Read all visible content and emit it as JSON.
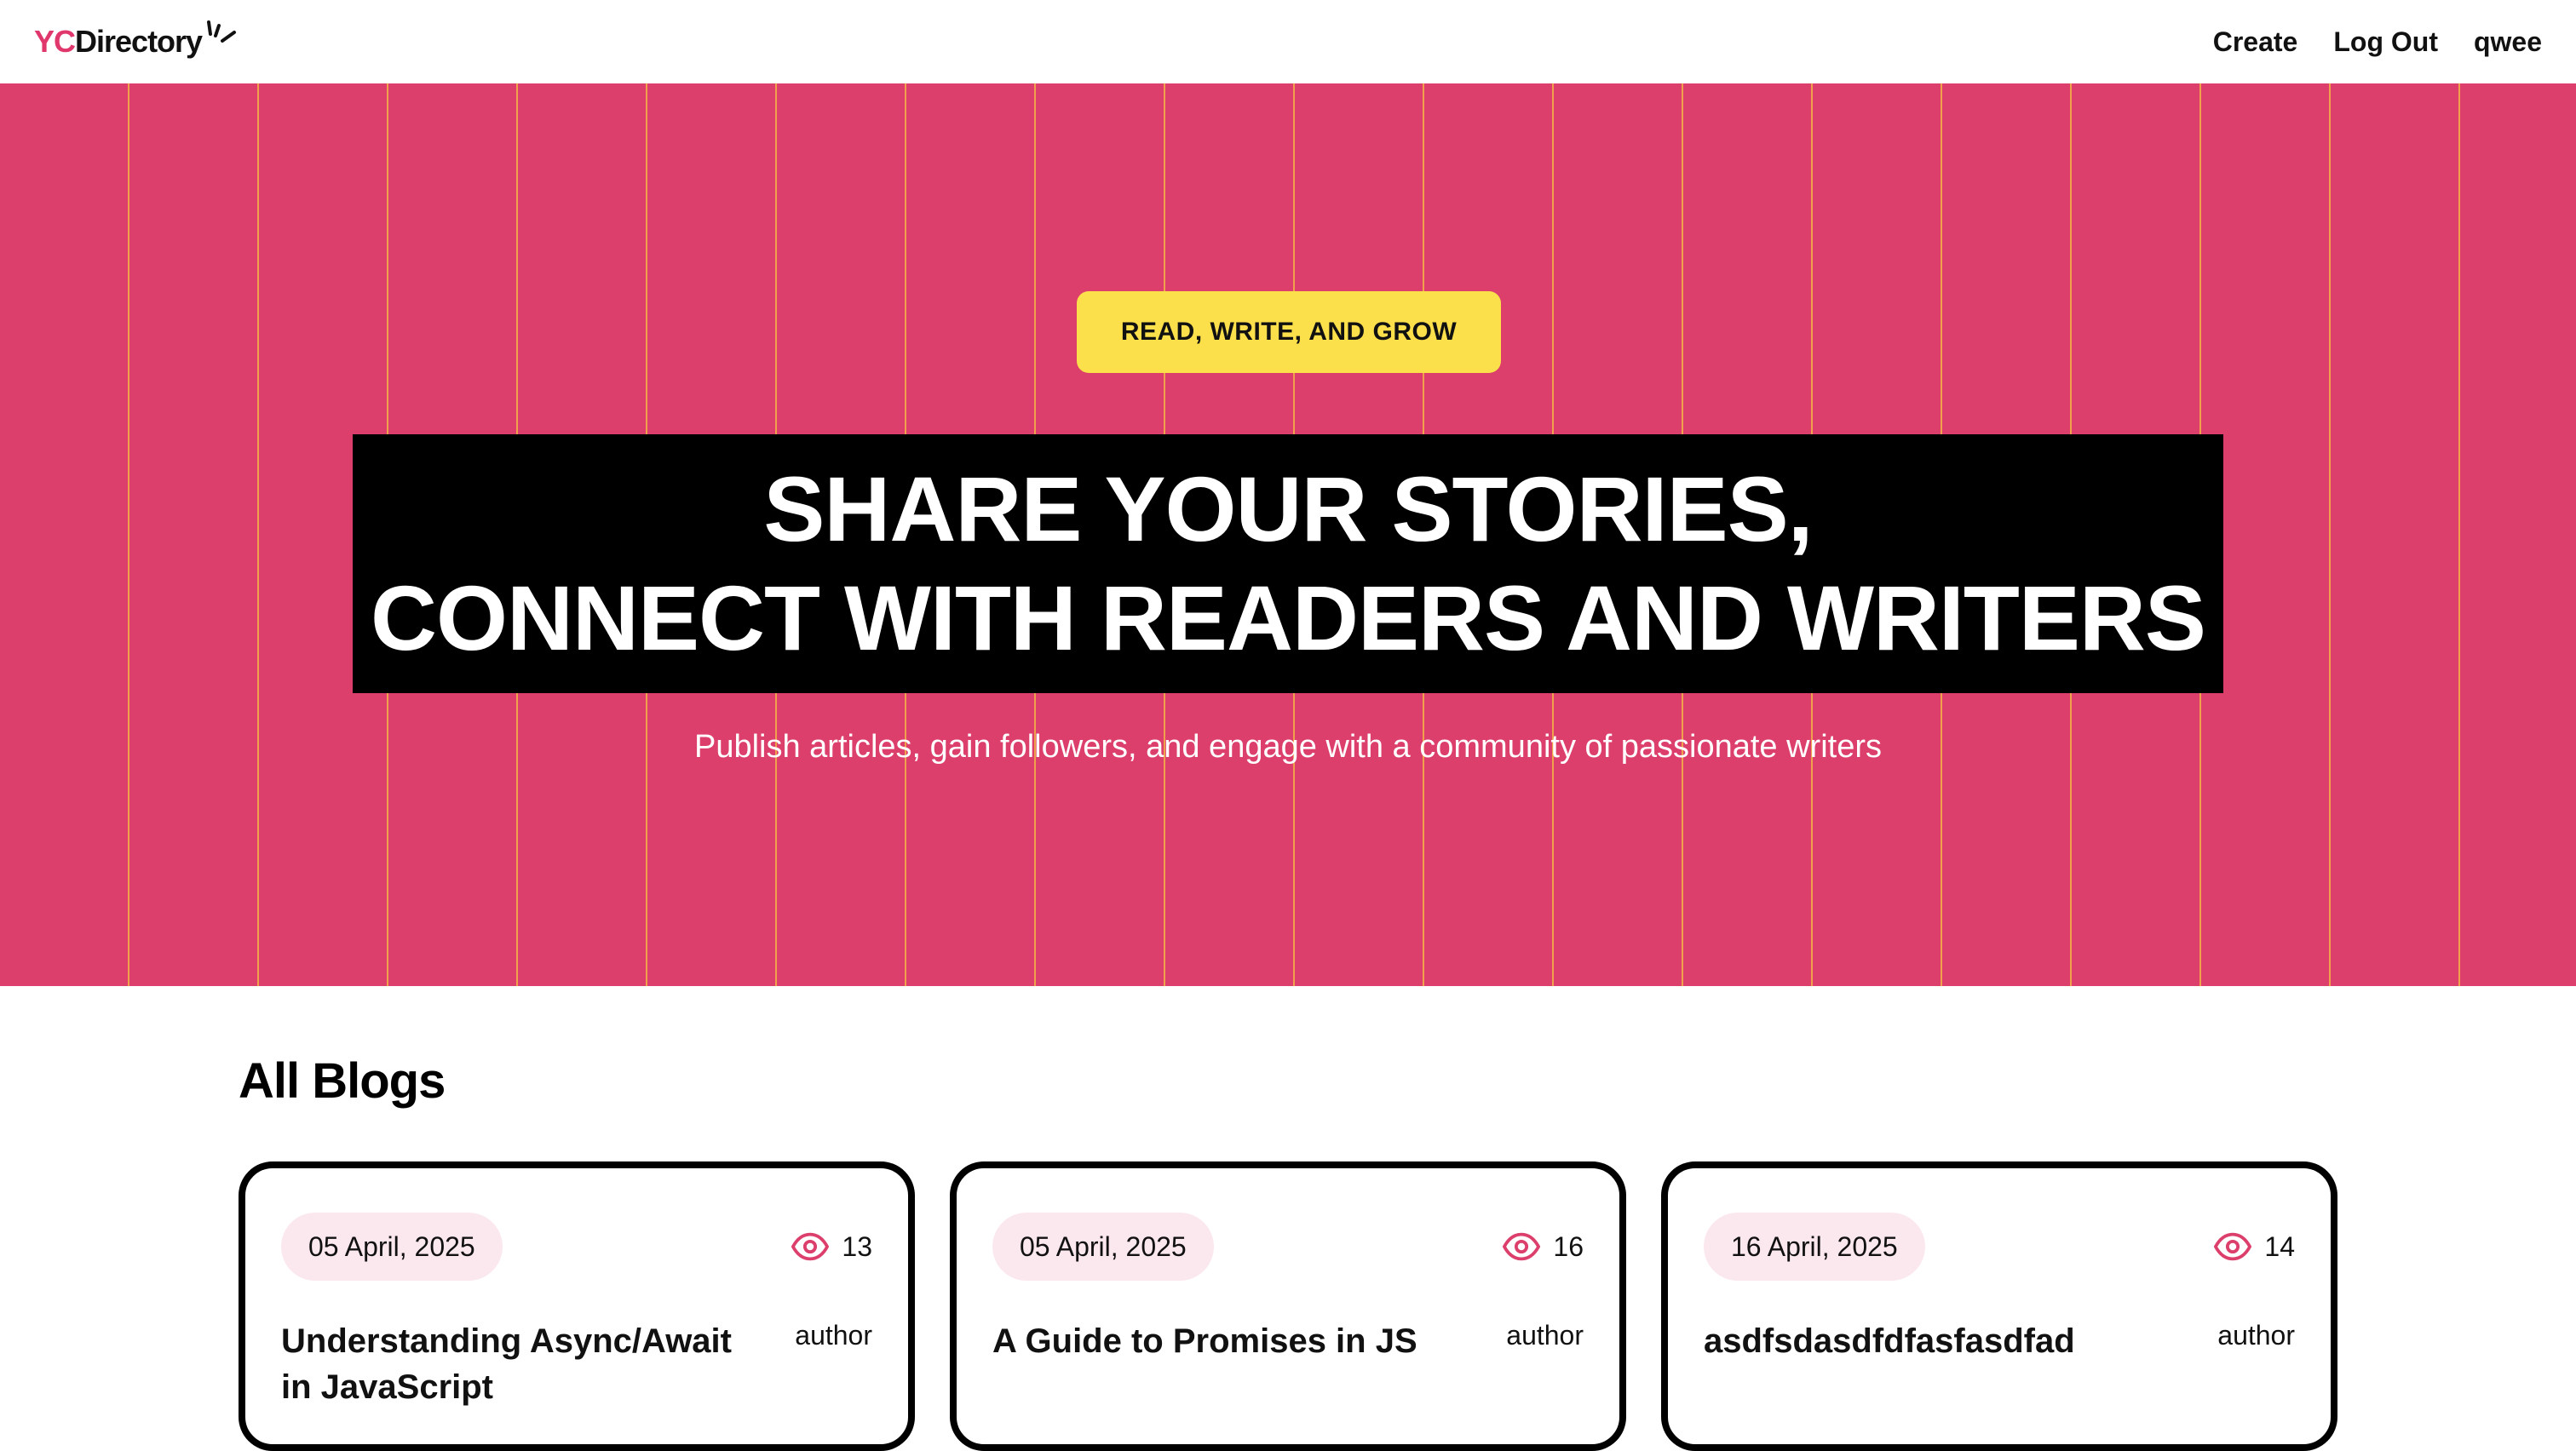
{
  "navbar": {
    "logo_prefix": "YC",
    "logo_suffix": "Directory",
    "links": {
      "create": "Create",
      "logout": "Log Out",
      "user": "qwee"
    }
  },
  "hero": {
    "tag": "READ, WRITE, AND GROW",
    "headline_line1": "SHARE YOUR STORIES,",
    "headline_line2": "CONNECT WITH READERS AND WRITERS",
    "subtitle": "Publish articles, gain followers, and engage with a community of passionate writers"
  },
  "blogs": {
    "section_title": "All Blogs",
    "cards": [
      {
        "date": "05 April, 2025",
        "views": "13",
        "title": "Understanding Async/Await in JavaScript",
        "author": "author"
      },
      {
        "date": "05 April, 2025",
        "views": "16",
        "title": "A Guide to Promises in JS",
        "author": "author"
      },
      {
        "date": "16 April, 2025",
        "views": "14",
        "title": "asdfsdasdfdfasfasdfad",
        "author": "author"
      }
    ]
  },
  "colors": {
    "brand_pink": "#dc3f6b",
    "accent_yellow": "#fbe04c",
    "stripe_orange": "#f0a04a",
    "date_chip_bg": "#fbe8ee"
  },
  "icons": {
    "logo_spark": "spark-icon",
    "views": "eye-icon"
  }
}
